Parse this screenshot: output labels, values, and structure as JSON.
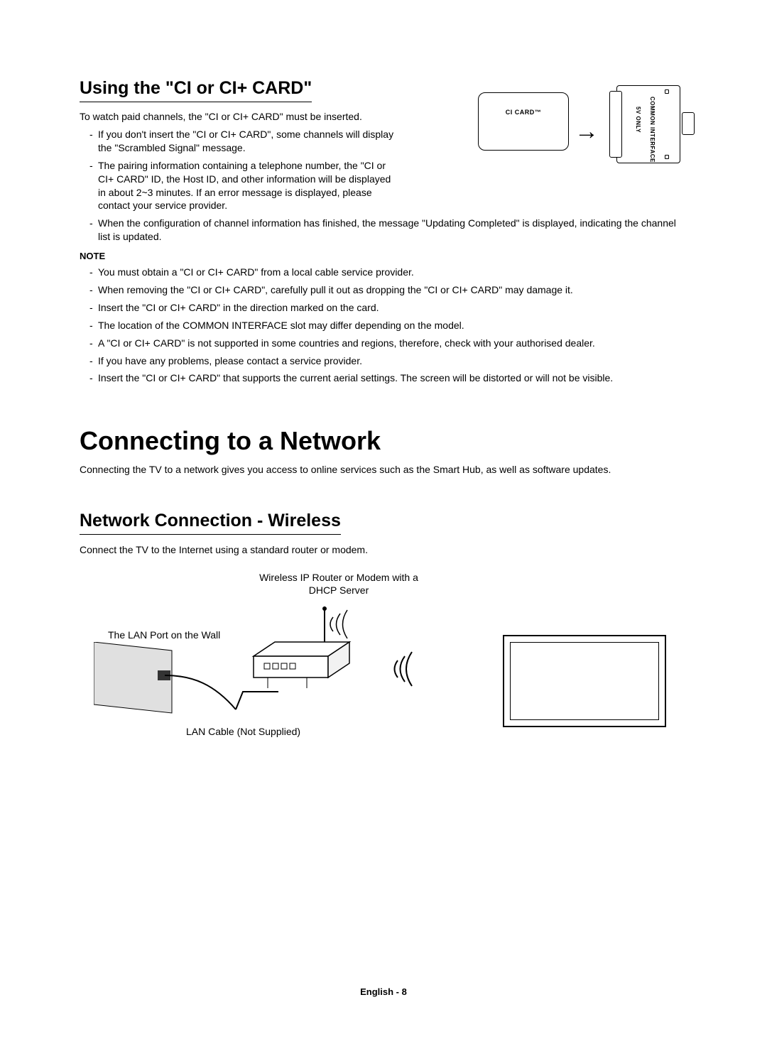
{
  "section1": {
    "heading": "Using the \"CI or CI+ CARD\"",
    "intro": "To watch paid channels, the \"CI or CI+ CARD\" must be inserted.",
    "bullets_top": [
      "If you don't insert the \"CI or CI+ CARD\", some channels will display the \"Scrambled Signal\" message.",
      "The pairing information containing a telephone number, the \"CI or CI+ CARD\" ID, the Host ID, and other information will be displayed in about 2~3 minutes. If an error message is displayed, please contact your service provider."
    ],
    "bullets_wide": [
      "When the configuration of channel information has finished, the message \"Updating Completed\" is displayed, indicating the channel list is updated."
    ],
    "note_label": "NOTE",
    "notes": [
      "You must obtain a \"CI or CI+ CARD\" from a local cable service provider.",
      "When removing the \"CI or CI+ CARD\", carefully pull it out as dropping the \"CI or CI+ CARD\" may damage it.",
      "Insert the \"CI or CI+ CARD\" in the direction marked on the card.",
      "The location of the COMMON INTERFACE slot may differ depending on the model.",
      "A \"CI or CI+ CARD\" is not supported in some countries and regions, therefore, check with your authorised dealer.",
      "If you have any problems, please contact a service provider.",
      "Insert the \"CI or CI+ CARD\" that supports the current aerial settings. The screen will be distorted or will not be visible."
    ],
    "figure": {
      "card_label": "CI CARD™",
      "slot_label1": "5V ONLY",
      "slot_label2": "COMMON INTERFACE"
    }
  },
  "section2": {
    "heading": "Connecting to a Network",
    "intro": "Connecting the TV to a network gives you access to online services such as the Smart Hub, as well as software updates."
  },
  "section3": {
    "heading": "Network Connection - Wireless",
    "intro": "Connect the TV to the Internet using a standard router or modem.",
    "router_caption": "Wireless IP Router or Modem with a DHCP Server",
    "lan_port_caption": "The LAN Port on the Wall",
    "lan_cable_caption": "LAN Cable (Not Supplied)"
  },
  "footer": "English - 8"
}
